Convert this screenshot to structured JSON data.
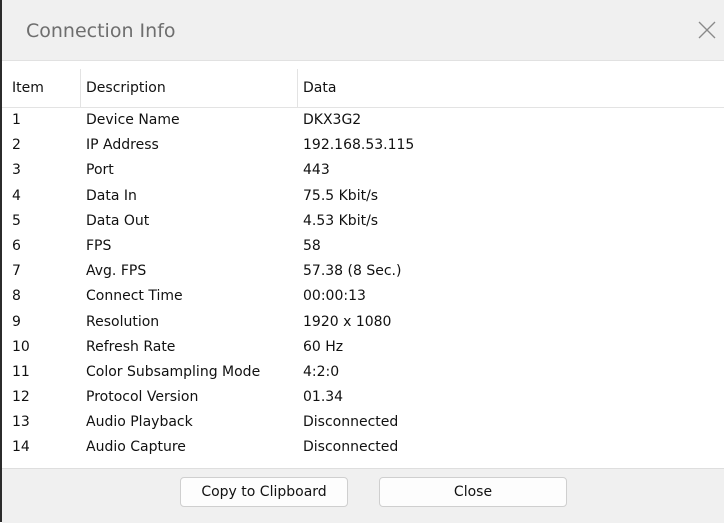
{
  "dialog": {
    "title": "Connection Info"
  },
  "table": {
    "headers": {
      "item": "Item",
      "description": "Description",
      "data": "Data"
    },
    "rows": [
      {
        "item": "1",
        "description": "Device Name",
        "data": "DKX3G2"
      },
      {
        "item": "2",
        "description": "IP Address",
        "data": "192.168.53.115"
      },
      {
        "item": "3",
        "description": "Port",
        "data": "443"
      },
      {
        "item": "4",
        "description": "Data In",
        "data": "75.5 Kbit/s"
      },
      {
        "item": "5",
        "description": "Data Out",
        "data": "4.53 Kbit/s"
      },
      {
        "item": "6",
        "description": "FPS",
        "data": "58"
      },
      {
        "item": "7",
        "description": "Avg. FPS",
        "data": "57.38 (8 Sec.)"
      },
      {
        "item": "8",
        "description": "Connect Time",
        "data": "00:00:13"
      },
      {
        "item": "9",
        "description": "Resolution",
        "data": "1920 x 1080"
      },
      {
        "item": "10",
        "description": "Refresh Rate",
        "data": "60 Hz"
      },
      {
        "item": "11",
        "description": "Color Subsampling Mode",
        "data": "4:2:0"
      },
      {
        "item": "12",
        "description": "Protocol Version",
        "data": "01.34"
      },
      {
        "item": "13",
        "description": "Audio Playback",
        "data": "Disconnected"
      },
      {
        "item": "14",
        "description": "Audio Capture",
        "data": "Disconnected"
      }
    ]
  },
  "footer": {
    "copy_label": "Copy to Clipboard",
    "close_label": "Close"
  },
  "icons": {
    "close": "close-icon"
  },
  "colors": {
    "title_text": "#6e6e6e",
    "chrome_background": "#f0f0f0",
    "content_background": "#ffffff"
  }
}
